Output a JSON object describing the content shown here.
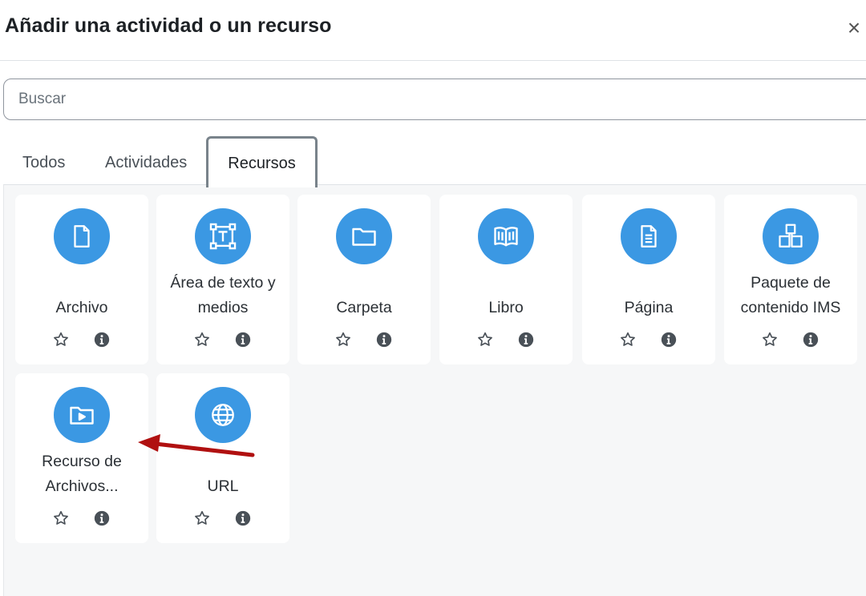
{
  "dialog": {
    "title": "Añadir una actividad o un recurso",
    "close_label": "×"
  },
  "search": {
    "placeholder": "Buscar",
    "value": ""
  },
  "tabs": [
    {
      "label": "Todos",
      "active": false
    },
    {
      "label": "Actividades",
      "active": false
    },
    {
      "label": "Recursos",
      "active": true
    }
  ],
  "colors": {
    "icon_circle": "#3b98e3",
    "annotation_arrow": "#b01010",
    "content_background": "#f6f7f8"
  },
  "resources": [
    {
      "label": "Archivo",
      "icon": "file-icon"
    },
    {
      "label": "Área de texto y medios",
      "icon": "text-area-icon"
    },
    {
      "label": "Carpeta",
      "icon": "folder-icon"
    },
    {
      "label": "Libro",
      "icon": "book-icon"
    },
    {
      "label": "Página",
      "icon": "page-icon"
    },
    {
      "label": "Paquete de contenido IMS",
      "icon": "ims-package-icon"
    },
    {
      "label": "Recurso de Archivos...",
      "icon": "folder-play-icon"
    },
    {
      "label": "URL",
      "icon": "globe-icon"
    }
  ],
  "annotation": {
    "type": "arrow",
    "points_to": "Recurso de Archivos..."
  }
}
